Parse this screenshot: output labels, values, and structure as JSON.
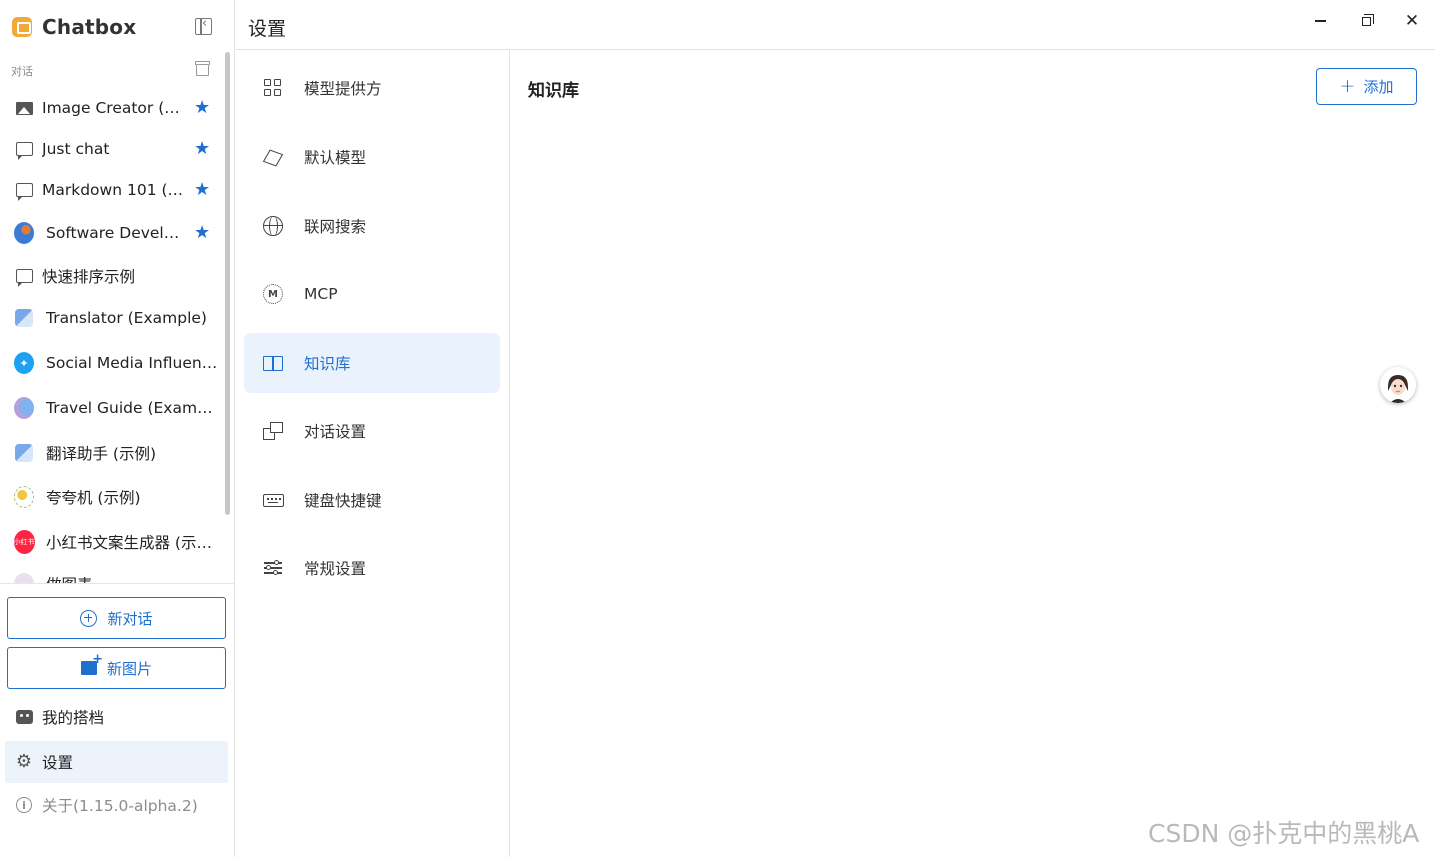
{
  "app": {
    "name": "Chatbox"
  },
  "sidebar": {
    "section_label": "对话",
    "conversations": [
      {
        "title": "Image Creator (E…",
        "icon": "image-icon",
        "starred": true
      },
      {
        "title": "Just chat",
        "icon": "chat-bubble-icon",
        "starred": true
      },
      {
        "title": "Markdown 101 (…",
        "icon": "chat-bubble-icon",
        "starred": true
      },
      {
        "title": "Software Develo…",
        "icon": "developer-avatar",
        "starred": true
      },
      {
        "title": "快速排序示例",
        "icon": "chat-bubble-icon",
        "starred": false
      },
      {
        "title": "Translator (Example)",
        "icon": "translator-avatar",
        "starred": false
      },
      {
        "title": "Social Media Influenc…",
        "icon": "twitter-avatar",
        "starred": false
      },
      {
        "title": "Travel Guide (Example)",
        "icon": "travel-avatar",
        "starred": false
      },
      {
        "title": "翻译助手 (示例)",
        "icon": "translator-avatar",
        "starred": false
      },
      {
        "title": "夸夸机 (示例)",
        "icon": "praise-avatar",
        "starred": false
      },
      {
        "title": "小红书文案生成器 (示…",
        "icon": "xiaohongshu-avatar",
        "avatar_text": "小红书",
        "starred": false
      },
      {
        "title": "做图表",
        "icon": "chart-avatar",
        "starred": false
      }
    ],
    "new_chat_label": "新对话",
    "new_image_label": "新图片",
    "my_copilots_label": "我的搭档",
    "settings_label": "设置",
    "about_label": "关于(1.15.0-alpha.2)"
  },
  "header": {
    "title": "设置"
  },
  "settings_nav": {
    "items": [
      {
        "label": "模型提供方",
        "icon": "grid-icon",
        "active": false
      },
      {
        "label": "默认模型",
        "icon": "cube-icon",
        "active": false
      },
      {
        "label": "联网搜索",
        "icon": "globe-icon",
        "active": false
      },
      {
        "label": "MCP",
        "icon": "mcp-icon",
        "active": false
      },
      {
        "label": "知识库",
        "icon": "book-icon",
        "active": true
      },
      {
        "label": "对话设置",
        "icon": "chat-settings-icon",
        "active": false
      },
      {
        "label": "键盘快捷键",
        "icon": "keyboard-icon",
        "active": false
      },
      {
        "label": "常规设置",
        "icon": "sliders-icon",
        "active": false
      }
    ]
  },
  "main": {
    "title": "知识库",
    "add_button_label": "添加"
  },
  "watermark": "CSDN @扑克中的黑桃A",
  "colors": {
    "accent": "#1f6fd1",
    "active_bg": "#e9f2fd",
    "star": "#1f6fd1"
  }
}
